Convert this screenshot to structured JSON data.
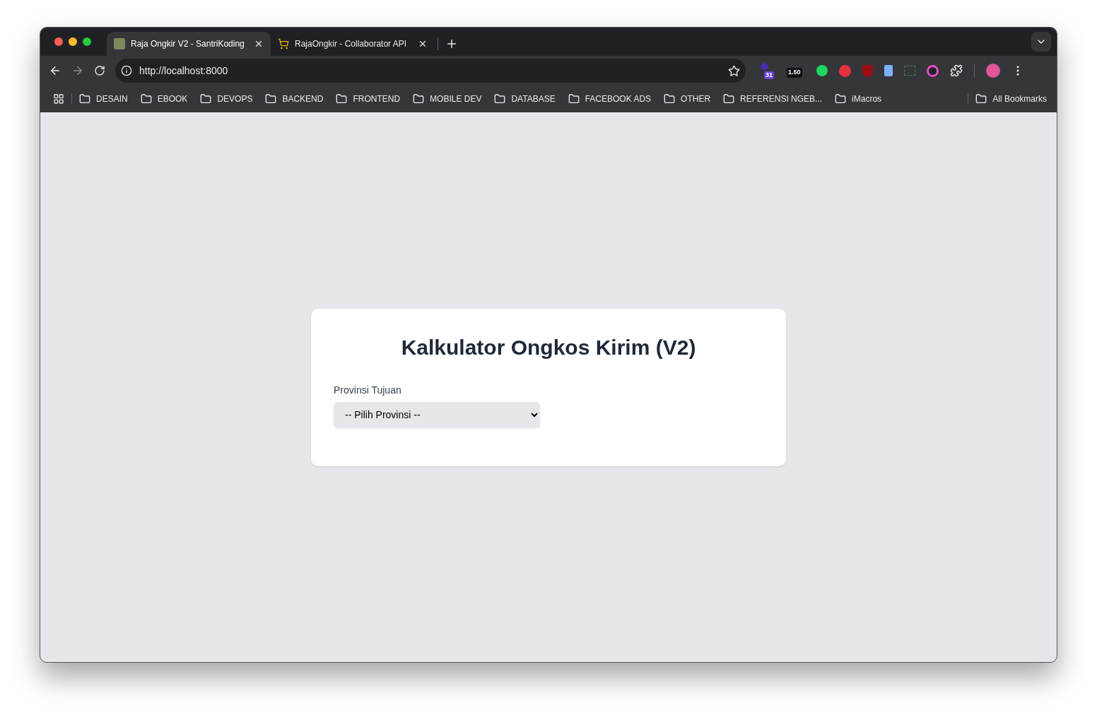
{
  "tabs": [
    {
      "title": "Raja Ongkir V2 - SantriKoding",
      "selected": true
    },
    {
      "title": "RajaOngkir - Collaborator API",
      "selected": false
    }
  ],
  "address_bar": {
    "url": "http://localhost:8000"
  },
  "extension_badges": [
    "31",
    "1.50"
  ],
  "bookmarks": [
    "DESAIN",
    "EBOOK",
    "DEVOPS",
    "BACKEND",
    "FRONTEND",
    "MOBILE DEV",
    "DATABASE",
    "FACEBOOK ADS",
    "OTHER",
    "REFERENSI NGEB...",
    "iMacros"
  ],
  "all_bookmarks": "All Bookmarks",
  "card": {
    "title": "Kalkulator Ongkos Kirim (V2)",
    "field_label": "Provinsi Tujuan",
    "select_value": "-- Pilih Provinsi --"
  }
}
